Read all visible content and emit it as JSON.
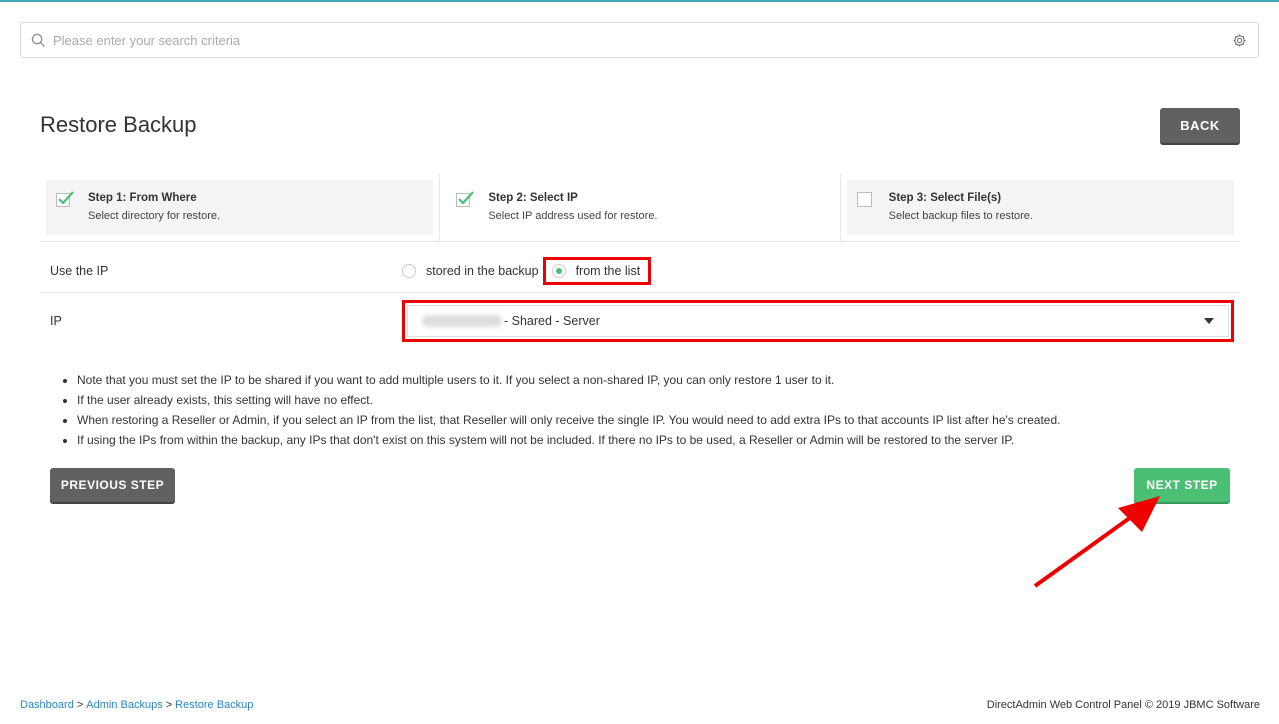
{
  "search": {
    "placeholder": "Please enter your search criteria"
  },
  "page": {
    "title": "Restore Backup",
    "back_label": "BACK"
  },
  "steps": [
    {
      "title": "Step 1: From Where",
      "desc": "Select directory for restore.",
      "status": "done"
    },
    {
      "title": "Step 2: Select IP",
      "desc": "Select IP address used for restore.",
      "status": "active"
    },
    {
      "title": "Step 3: Select File(s)",
      "desc": "Select backup files to restore.",
      "status": "todo"
    }
  ],
  "use_ip": {
    "label": "Use the IP",
    "options": [
      {
        "label": "stored in the backup",
        "selected": false
      },
      {
        "label": "from the list",
        "selected": true
      }
    ]
  },
  "ip": {
    "label": "IP",
    "selected_value": "- Shared - Server"
  },
  "notes": [
    "Note that you must set the IP to be shared if you want to add multiple users to it. If you select a non-shared IP, you can only restore 1 user to it.",
    "If the user already exists, this setting will have no effect.",
    "When restoring a Reseller or Admin, if you select an IP from the list, that Reseller will only receive the single IP. You would need to add extra IPs to that accounts IP list after he's created.",
    "If using the IPs from within the backup, any IPs that don't exist on this system will not be included. If there no IPs to be used, a Reseller or Admin will be restored to the server IP."
  ],
  "buttons": {
    "previous": "PREVIOUS STEP",
    "next": "NEXT STEP"
  },
  "footer": {
    "breadcrumb": [
      "Dashboard",
      "Admin Backups",
      "Restore Backup"
    ],
    "separator": ">",
    "copyright": "DirectAdmin Web Control Panel © 2019 JBMC Software"
  },
  "colors": {
    "accent_green": "#4bbf73",
    "highlight_red": "#e00000",
    "button_gray": "#616161",
    "link_blue": "#2a85c5"
  },
  "icons": {
    "search": "search-icon",
    "settings": "gear-icon",
    "check": "check-icon",
    "dropdown": "chevron-down-icon"
  }
}
